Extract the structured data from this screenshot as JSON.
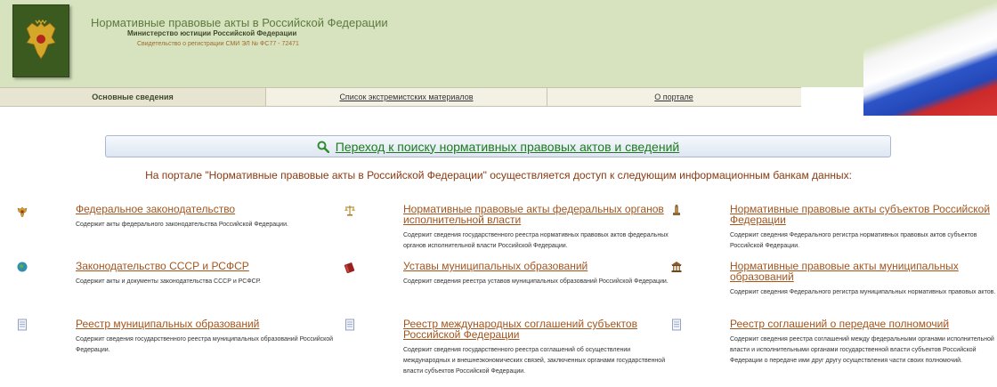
{
  "header": {
    "title": "Нормативные правовые акты в Российской Федерации",
    "subtitle": "Министерство юстиции Российской Федерации",
    "registration": "Свидетельство о регистрации СМИ ЭЛ № ФС77 - 72471"
  },
  "nav": {
    "items": [
      {
        "label": "Основные сведения"
      },
      {
        "label": "Список экстремистских материалов"
      },
      {
        "label": "О портале"
      }
    ]
  },
  "search": {
    "label": "Переход к поиску нормативных правовых актов и сведений",
    "icon": "search-icon",
    "icon_color": "#2e8b2e"
  },
  "intro": "На портале \"Нормативные правовые акты в Российской Федерации\" осуществляется доступ к следующим информационным банкам данных:",
  "banks": [
    {
      "title": "Федеральное законодательство",
      "desc": "Содержит акты федерального законодательства Российской Федерации.",
      "icon": "eagle-icon"
    },
    {
      "title": "Нормативные правовые акты федеральных органов исполнительной власти",
      "desc": "Содержит сведения государственного реестра нормативных правовых актов федеральных органов исполнительной власти Российской Федерации.",
      "icon": "scales-icon"
    },
    {
      "title": "Нормативные правовые акты субъектов Российской Федерации",
      "desc": "Содержит сведения Федерального регистра нормативных правовых актов субъектов Российской Федерации.",
      "icon": "monument-icon"
    },
    {
      "title": "Законодательство СССР и РСФСР",
      "desc": "Содержит акты и документы законодательства СССР и РСФСР.",
      "icon": "globe-icon"
    },
    {
      "title": "Уставы муниципальных образований",
      "desc": "Содержит сведения реестра уставов муниципальных образований Российской Федерации.",
      "icon": "book-icon"
    },
    {
      "title": "Нормативные правовые акты муниципальных образований",
      "desc": "Содержит сведения Федерального регистра муниципальных нормативных правовых актов.",
      "icon": "building-icon"
    },
    {
      "title": "Реестр муниципальных образований",
      "desc": "Содержит сведения государственного реестра муниципальных образований Российской Федерации.",
      "icon": "document-icon"
    },
    {
      "title": "Реестр международных соглашений субъектов Российской Федерации",
      "desc": "Содержит сведения государственного реестра соглашений об осуществлении международных и внешнеэкономических связей, заключенных органами государственной власти субъектов Российской Федерации.",
      "icon": "document-icon"
    },
    {
      "title": "Реестр соглашений о передаче полномочий",
      "desc": "Содержит сведения реестра соглашений между федеральными органами исполнительной власти и исполнительными органами государственной власти субъектов Российской Федерации о передаче ими друг другу осуществления части своих полномочий.",
      "icon": "document-icon"
    }
  ]
}
